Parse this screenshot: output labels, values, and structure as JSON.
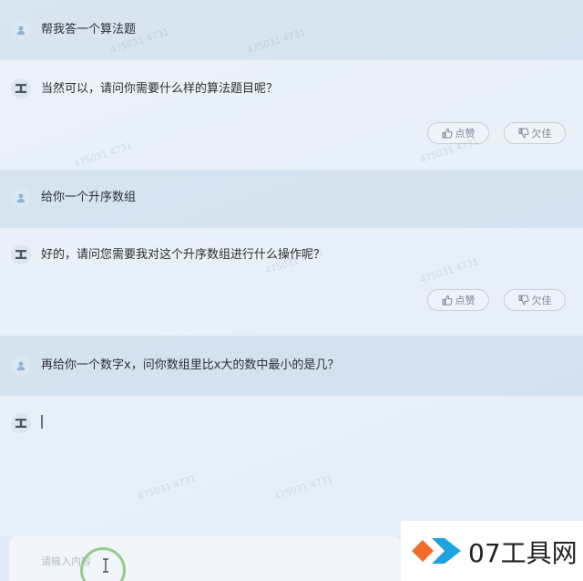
{
  "conversation": [
    {
      "role": "user",
      "text": "帮我答一个算法题"
    },
    {
      "role": "assistant",
      "text": "当然可以，请问你需要什么样的算法题目呢？"
    },
    {
      "role": "user",
      "text": "给你一个升序数组"
    },
    {
      "role": "assistant",
      "text": "好的，请问您需要我对这个升序数组进行什么操作呢？"
    },
    {
      "role": "user",
      "text": "再给你一个数字x，问你数组里比x大的数中最小的是几？"
    },
    {
      "role": "assistant",
      "text": ""
    }
  ],
  "feedback": {
    "like_label": "点赞",
    "dislike_label": "欠佳"
  },
  "input": {
    "placeholder": "请输入内容"
  },
  "watermark": {
    "brand": "07工具网",
    "faint_text": "475031 4731"
  },
  "colors": {
    "user_avatar_bg": "#dbe7f3",
    "user_avatar_icon": "#8fb2d6",
    "ai_icon": "#4a5563",
    "click_ring": "#86c478",
    "brand_orange": "#f26b2a",
    "brand_blue": "#1fa3e0"
  },
  "icons": {
    "user_avatar": "person-icon",
    "ai_avatar": "ai-logo-icon",
    "like": "thumbs-up-icon",
    "dislike": "thumbs-down-icon"
  }
}
